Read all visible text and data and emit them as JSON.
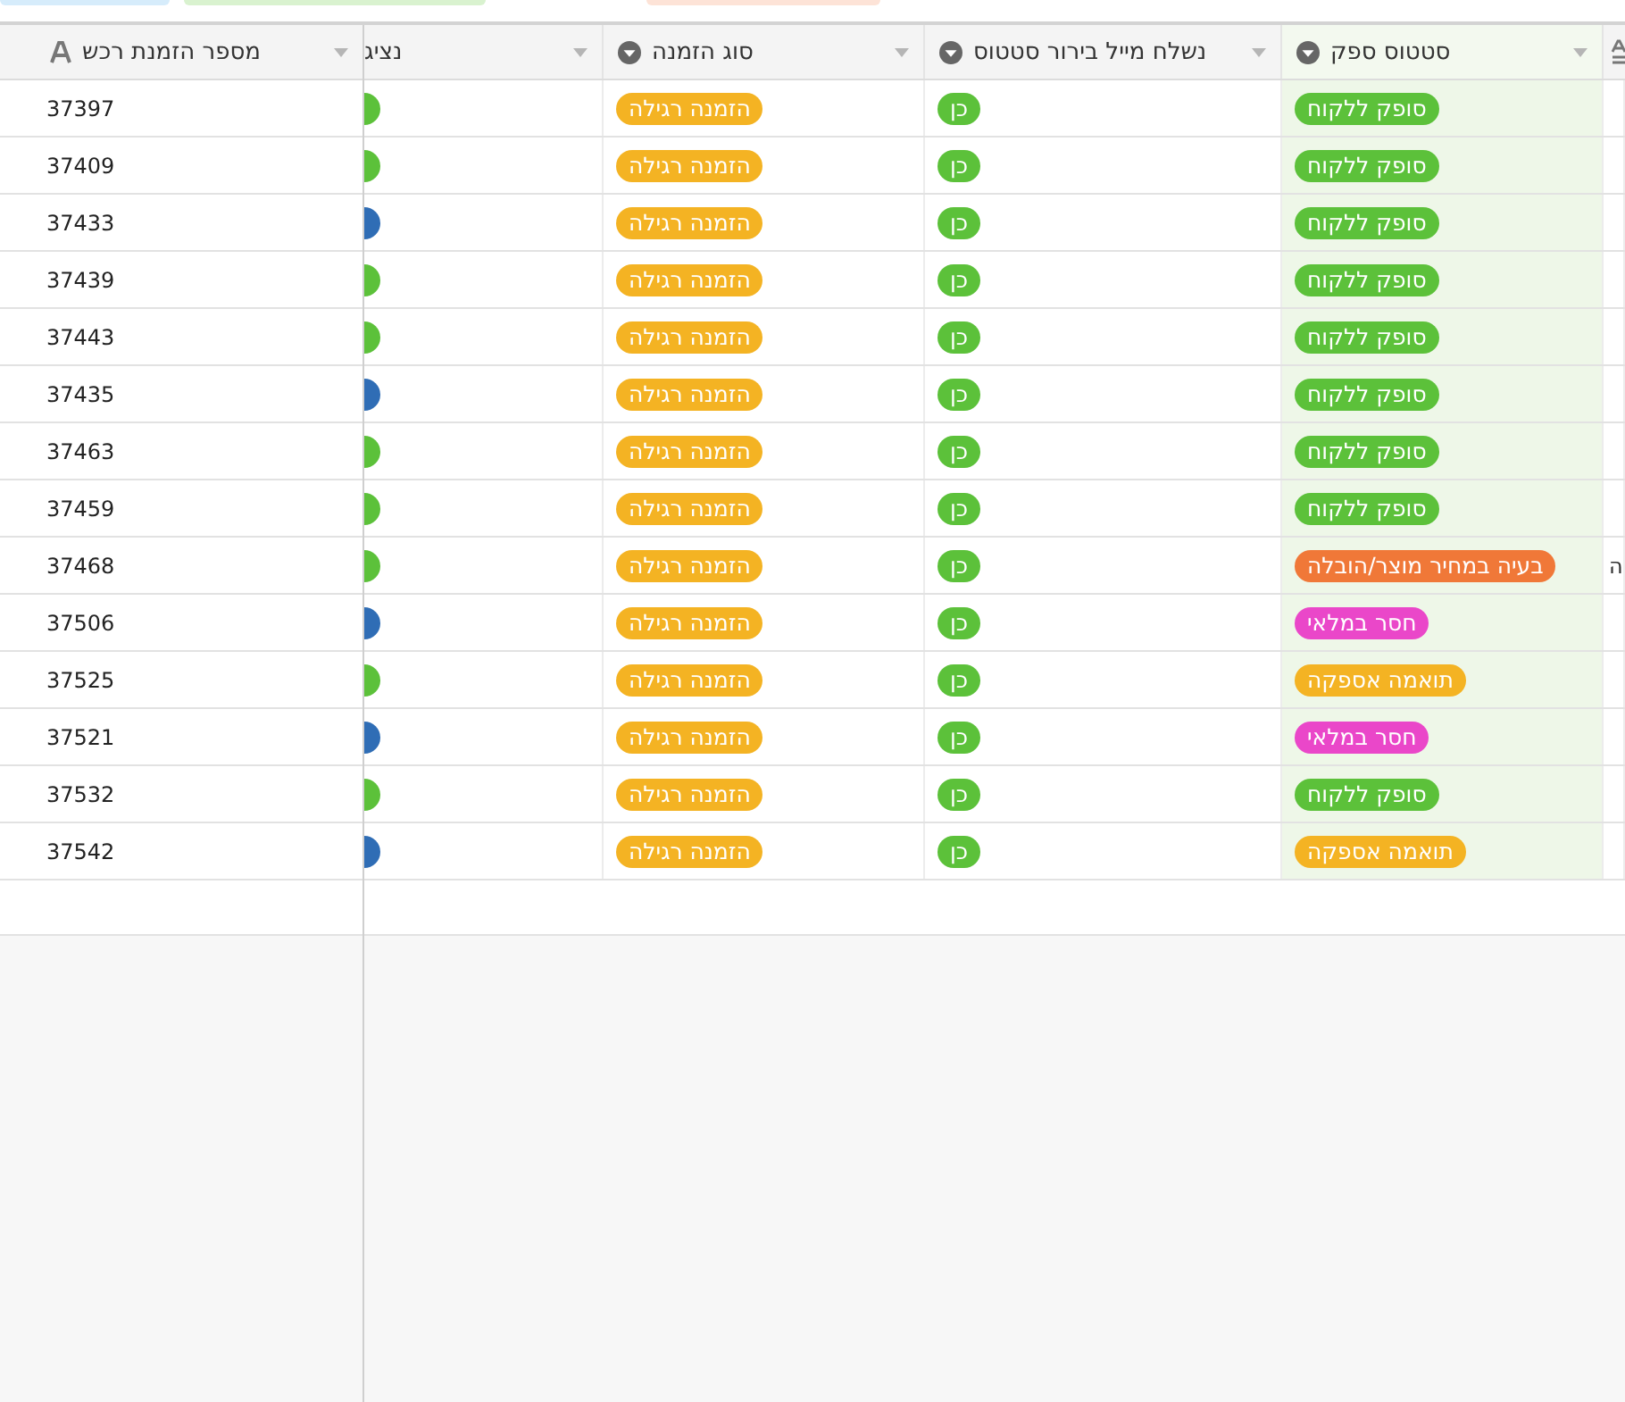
{
  "view_tabs": [
    {
      "color": "#d6ecfb"
    },
    {
      "color": "#d9f2cf"
    },
    {
      "color": "#fde3d7"
    }
  ],
  "table": {
    "primary_column": {
      "label": "מספר הזמנת רכש"
    },
    "columns": [
      {
        "kind": "text"
      },
      {
        "kind": "pill",
        "label": "סטטוס ספק",
        "highlighted": true
      },
      {
        "kind": "pill",
        "label": "נשלח מייל בירור סטטוס"
      },
      {
        "kind": "pill",
        "label": "סוג הזמנה"
      },
      {
        "kind": "avatar",
        "label": "נציג"
      }
    ],
    "rows": [
      {
        "number": "37397",
        "cells": [
          {},
          {
            "label": "סופק ללקוח",
            "color": "#5cc13a"
          },
          {
            "label": "כן",
            "color": "#5cc13a"
          },
          {
            "label": "הזמנה רגילה",
            "color": "#f4b323"
          },
          {
            "color": "#5cc13a"
          }
        ]
      },
      {
        "number": "37409",
        "cells": [
          {},
          {
            "label": "סופק ללקוח",
            "color": "#5cc13a"
          },
          {
            "label": "כן",
            "color": "#5cc13a"
          },
          {
            "label": "הזמנה רגילה",
            "color": "#f4b323"
          },
          {
            "color": "#5cc13a"
          }
        ]
      },
      {
        "number": "37433",
        "cells": [
          {},
          {
            "label": "סופק ללקוח",
            "color": "#5cc13a"
          },
          {
            "label": "כן",
            "color": "#5cc13a"
          },
          {
            "label": "הזמנה רגילה",
            "color": "#f4b323"
          },
          {
            "color": "#2f6db5"
          }
        ]
      },
      {
        "number": "37439",
        "cells": [
          {},
          {
            "label": "סופק ללקוח",
            "color": "#5cc13a"
          },
          {
            "label": "כן",
            "color": "#5cc13a"
          },
          {
            "label": "הזמנה רגילה",
            "color": "#f4b323"
          },
          {
            "color": "#5cc13a"
          }
        ]
      },
      {
        "number": "37443",
        "cells": [
          {},
          {
            "label": "סופק ללקוח",
            "color": "#5cc13a"
          },
          {
            "label": "כן",
            "color": "#5cc13a"
          },
          {
            "label": "הזמנה רגילה",
            "color": "#f4b323"
          },
          {
            "color": "#5cc13a"
          }
        ]
      },
      {
        "number": "37435",
        "cells": [
          {},
          {
            "label": "סופק ללקוח",
            "color": "#5cc13a"
          },
          {
            "label": "כן",
            "color": "#5cc13a"
          },
          {
            "label": "הזמנה רגילה",
            "color": "#f4b323"
          },
          {
            "color": "#2f6db5"
          }
        ]
      },
      {
        "number": "37463",
        "cells": [
          {},
          {
            "label": "סופק ללקוח",
            "color": "#5cc13a"
          },
          {
            "label": "כן",
            "color": "#5cc13a"
          },
          {
            "label": "הזמנה רגילה",
            "color": "#f4b323"
          },
          {
            "color": "#5cc13a"
          }
        ]
      },
      {
        "number": "37459",
        "cells": [
          {},
          {
            "label": "סופק ללקוח",
            "color": "#5cc13a"
          },
          {
            "label": "כן",
            "color": "#5cc13a"
          },
          {
            "label": "הזמנה רגילה",
            "color": "#f4b323"
          },
          {
            "color": "#5cc13a"
          }
        ]
      },
      {
        "number": "37468",
        "cells": [
          {
            "text": "ה"
          },
          {
            "label": "בעיה במחיר מוצר/הובלה",
            "color": "#f07838"
          },
          {
            "label": "כן",
            "color": "#5cc13a"
          },
          {
            "label": "הזמנה רגילה",
            "color": "#f4b323"
          },
          {
            "color": "#5cc13a"
          }
        ]
      },
      {
        "number": "37506",
        "cells": [
          {},
          {
            "label": "חסר במלאי",
            "color": "#ea47c9"
          },
          {
            "label": "כן",
            "color": "#5cc13a"
          },
          {
            "label": "הזמנה רגילה",
            "color": "#f4b323"
          },
          {
            "color": "#2f6db5"
          }
        ]
      },
      {
        "number": "37525",
        "cells": [
          {},
          {
            "label": "תואמה אספקה",
            "color": "#f4b323"
          },
          {
            "label": "כן",
            "color": "#5cc13a"
          },
          {
            "label": "הזמנה רגילה",
            "color": "#f4b323"
          },
          {
            "color": "#5cc13a"
          }
        ]
      },
      {
        "number": "37521",
        "cells": [
          {},
          {
            "label": "חסר במלאי",
            "color": "#ea47c9"
          },
          {
            "label": "כן",
            "color": "#5cc13a"
          },
          {
            "label": "הזמנה רגילה",
            "color": "#f4b323"
          },
          {
            "color": "#2f6db5"
          }
        ]
      },
      {
        "number": "37532",
        "cells": [
          {},
          {
            "label": "סופק ללקוח",
            "color": "#5cc13a"
          },
          {
            "label": "כן",
            "color": "#5cc13a"
          },
          {
            "label": "הזמנה רגילה",
            "color": "#f4b323"
          },
          {
            "color": "#5cc13a"
          }
        ]
      },
      {
        "number": "37542",
        "cells": [
          {},
          {
            "label": "תואמה אספקה",
            "color": "#f4b323"
          },
          {
            "label": "כן",
            "color": "#5cc13a"
          },
          {
            "label": "הזמנה רגילה",
            "color": "#f4b323"
          },
          {
            "color": "#2f6db5"
          }
        ]
      }
    ]
  }
}
